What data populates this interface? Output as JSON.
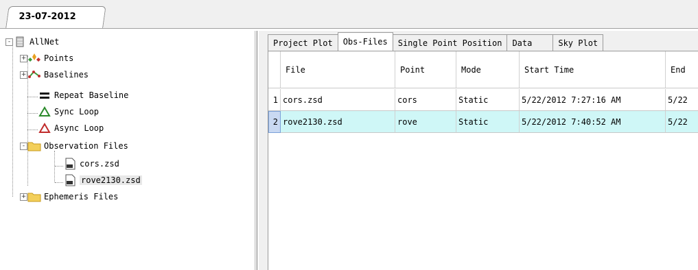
{
  "document_tab": {
    "label": "23-07-2012"
  },
  "tree": {
    "root": {
      "label": "AllNet",
      "icon": "database-icon"
    },
    "items": [
      {
        "label": "Points",
        "icon": "points-icon",
        "expander": "+"
      },
      {
        "label": "Baselines",
        "icon": "baselines-icon",
        "expander": "+"
      },
      {
        "label": "Repeat Baseline",
        "icon": "equals-icon"
      },
      {
        "label": "Sync Loop",
        "icon": "triangle-loop-icon"
      },
      {
        "label": "Async Loop",
        "icon": "triangle-loop-red-icon"
      },
      {
        "label": "Observation Files",
        "icon": "folder-icon",
        "expander": "-"
      },
      {
        "label": "cors.zsd",
        "icon": "zsd-file-icon"
      },
      {
        "label": "rove2130.zsd",
        "icon": "zsd-file-icon",
        "selected": true
      },
      {
        "label": "Ephemeris Files",
        "icon": "folder-icon",
        "expander": "+"
      }
    ],
    "root_expander": "-"
  },
  "tabs": [
    {
      "label": "Project Plot"
    },
    {
      "label": "Obs-Files",
      "active": true
    },
    {
      "label": "Single Point Position"
    },
    {
      "label": "Data"
    },
    {
      "label": "Sky Plot"
    }
  ],
  "grid": {
    "columns": [
      "",
      "File",
      "Point",
      "Mode",
      "Start Time",
      "End"
    ],
    "rows": [
      {
        "num": "1",
        "file": "cors.zsd",
        "point": "cors",
        "mode": "Static",
        "start": "5/22/2012 7:27:16 AM",
        "end": "5/22"
      },
      {
        "num": "2",
        "file": "rove2130.zsd",
        "point": "rove",
        "mode": "Static",
        "start": "5/22/2012 7:40:52 AM",
        "end": "5/22",
        "selected": true
      }
    ]
  },
  "colors": {
    "selected_row": "#cff7f7",
    "window_bg": "#f0f0f0"
  }
}
